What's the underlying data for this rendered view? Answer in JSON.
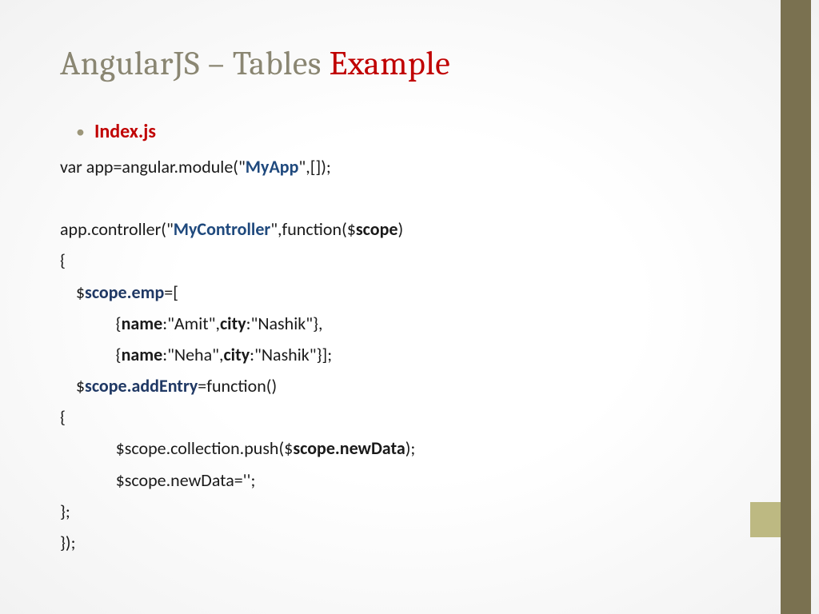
{
  "title": {
    "prefix": "AngularJS – Tables ",
    "accent": "Example"
  },
  "bullet": "Index.js",
  "code": {
    "l1a": "var app=angular.module(\"",
    "l1b": "MyApp",
    "l1c": "\",[]);",
    "l2a": "app.controller(\"",
    "l2b": "MyController",
    "l2c": "\",function($",
    "l2d": "scope",
    "l2e": ")",
    "l3": "{",
    "l4a": "    $",
    "l4b": "scope.emp",
    "l4c": "=[",
    "l5a": "              {",
    "l5b": "name",
    "l5c": ":\"Amit\",",
    "l5d": "city",
    "l5e": ":\"Nashik\"},",
    "l6a": "              {",
    "l6b": "name",
    "l6c": ":\"Neha\",",
    "l6d": "city",
    "l6e": ":\"Nashik\"}];",
    "l7a": "    $",
    "l7b": "scope.addEntry",
    "l7c": "=function()",
    "l8": "{",
    "l9a": "              $scope.collection.push($",
    "l9b": "scope.newData",
    "l9c": ");",
    "l10": "              $scope.newData='';",
    "l11": "};",
    "l12": "});"
  }
}
